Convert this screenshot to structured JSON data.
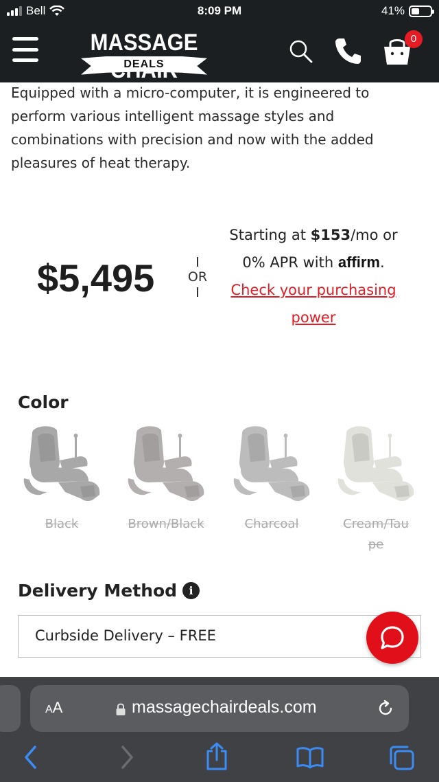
{
  "status_bar": {
    "carrier": "Bell",
    "time": "8:09 PM",
    "battery": "41%",
    "battery_level": 0.41
  },
  "header": {
    "logo_title": "MASSAGE CHAIR",
    "logo_subtitle": "DEALS",
    "cart_count": "0",
    "icons": [
      "menu-icon",
      "search-icon",
      "phone-icon",
      "cart-icon"
    ]
  },
  "description": {
    "line1": "Equipped with a micro-computer, it is engineered to",
    "line2": "perform various intelligent massage styles and",
    "line3": "combinations with precision and now with the added",
    "line4": "pleasures of heat therapy."
  },
  "pricing": {
    "price": "$5,495",
    "or": "OR",
    "starting_at": "Starting at ",
    "monthly": "$153",
    "per_month": "/mo or",
    "apr": "0% APR with ",
    "affirm": "affirm",
    "affirm_dot": ".",
    "check_line1": "Check your purchasing",
    "check_line2": "power"
  },
  "color": {
    "label": "Color",
    "options": [
      {
        "name": "Black",
        "tone": "#9a9a9a"
      },
      {
        "name": "Brown/Black",
        "tone": "#a5a2a0"
      },
      {
        "name": "Charcoal",
        "tone": "#b1b1b1"
      },
      {
        "name_line1": "Cream/Tau",
        "name_line2": "pe",
        "tone": "#dcdcd6"
      }
    ]
  },
  "delivery": {
    "label": "Delivery Method",
    "selected": "Curbside Delivery – FREE"
  },
  "browser": {
    "aa_label": "AA",
    "url": "massagechairdeals.com"
  },
  "colors": {
    "header_bg": "#1c1f22",
    "accent_red": "#e31b23",
    "safari_bar": "#3f4144"
  }
}
